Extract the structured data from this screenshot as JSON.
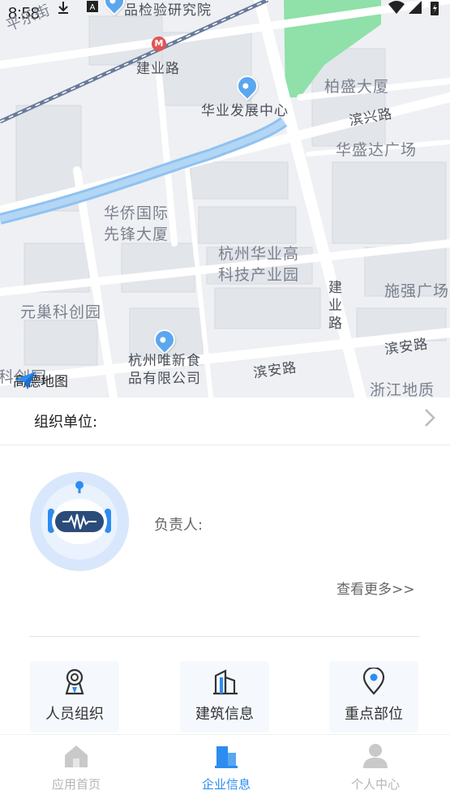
{
  "status_bar": {
    "time": "8:58"
  },
  "map": {
    "labels": {
      "pingle": "平乐街",
      "inspection": "品检验研究院",
      "jianye_road_top": "建业路",
      "huaye_center": "华业发展中心",
      "baisheng": "柏盛大厦",
      "binxing": "滨兴路",
      "huashengda": "华盛达广场",
      "huaqiao": "华侨国际\n先锋大厦",
      "hangzhou_huaye": "杭州华业高\n科技产业园",
      "jianye_road_v": "建\n业\n路",
      "shiqiang": "施强广场",
      "yuanchao": "元巢科创园",
      "weixin": "杭州唯新食\n品有限公司",
      "binan_left": "滨安路",
      "binan_right": "滨安路",
      "kechuang": "科创园",
      "zhejiang": "浙江地质"
    },
    "logo_text": "高德地图"
  },
  "org": {
    "label": "组织单位:"
  },
  "profile": {
    "responsible_label": "负责人:",
    "more_link": "查看更多>>"
  },
  "tiles": [
    {
      "label": "人员组织",
      "icon": "badge-person-icon"
    },
    {
      "label": "建筑信息",
      "icon": "building-icon"
    },
    {
      "label": "重点部位",
      "icon": "location-pin-icon"
    }
  ],
  "nav": [
    {
      "label": "应用首页",
      "icon": "home-icon",
      "active": false
    },
    {
      "label": "企业信息",
      "icon": "enterprise-icon",
      "active": true
    },
    {
      "label": "个人中心",
      "icon": "person-icon",
      "active": false
    }
  ],
  "colors": {
    "accent": "#2d8cf0",
    "inactive": "#b5b5b5",
    "tile_bg": "#f5f9fe"
  }
}
